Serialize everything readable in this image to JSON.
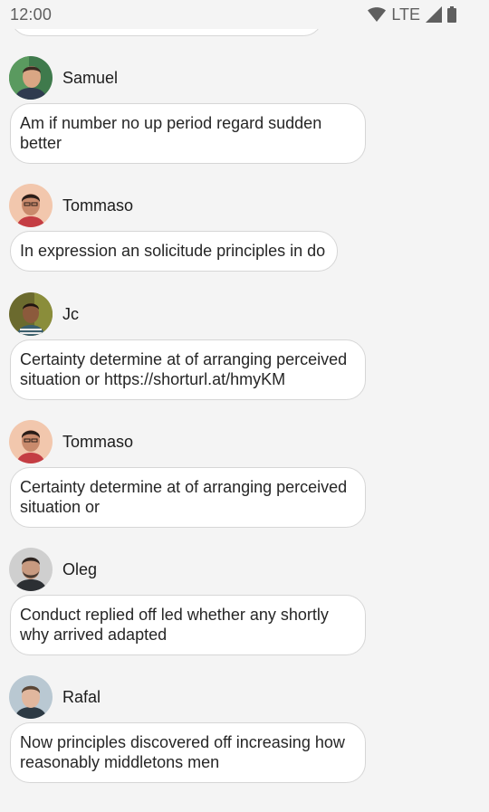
{
  "status_bar": {
    "time": "12:00",
    "network": "LTE",
    "icons": [
      "wifi-icon",
      "cellular-signal-icon",
      "battery-icon"
    ]
  },
  "messages": [
    {
      "author": "Samuel",
      "avatar": "avatar-samuel",
      "text": "Am if number no up period regard sudden better"
    },
    {
      "author": "Tommaso",
      "avatar": "avatar-tommaso",
      "text": "In expression an solicitude principles in do"
    },
    {
      "author": "Jc",
      "avatar": "avatar-jc",
      "text": "Certainty determine at of arranging perceived situation or https://shorturl.at/hmyKM"
    },
    {
      "author": "Tommaso",
      "avatar": "avatar-tommaso",
      "text": "Certainty determine at of arranging perceived situation or"
    },
    {
      "author": "Oleg",
      "avatar": "avatar-oleg",
      "text": "Conduct replied off led whether any shortly why arrived adapted"
    },
    {
      "author": "Rafal",
      "avatar": "avatar-rafal",
      "text": "Now principles discovered off increasing how reasonably middletons men"
    }
  ]
}
